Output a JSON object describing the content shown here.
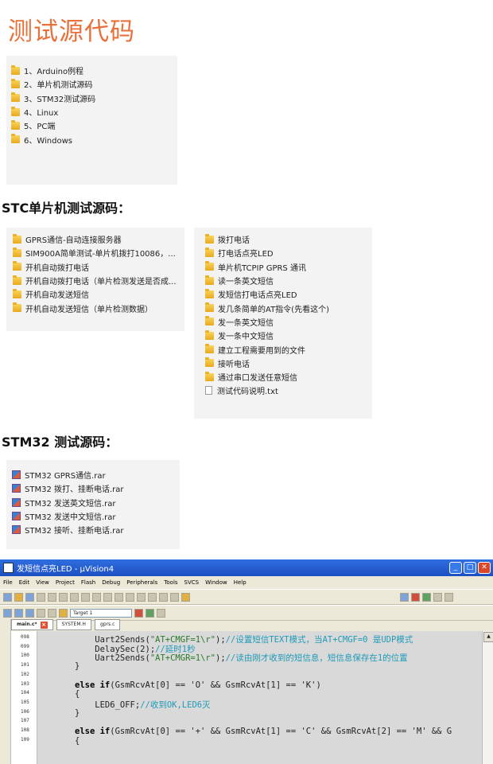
{
  "page_title": "测试源代码",
  "top_folders": [
    "1、Arduino例程",
    "2、单片机测试源码",
    "3、STM32测试源码",
    "4、Linux",
    "5、PC端",
    "6、Windows"
  ],
  "stc": {
    "heading": "STC单片机测试源码：",
    "left": [
      "GPRS通信-自动连接服务器",
      "SIM900A简单测试-单片机拨打10086，...",
      "开机自动拨打电话",
      "开机自动拨打电话（单片检测发送是否成...",
      "开机自动发送短信",
      "开机自动发送短信（单片检测数据）"
    ],
    "right_folders": [
      "拨打电话",
      "打电话点亮LED",
      "单片机TCPIP GPRS 通讯",
      "读一条英文短信",
      "发短信打电话点亮LED",
      "发几条简单的AT指令(先看这个)",
      "发一条英文短信",
      "发一条中文短信",
      "建立工程需要用到的文件",
      "接听电话",
      "通过串口发送任意短信"
    ],
    "right_file": "测试代码说明.txt"
  },
  "stm32": {
    "heading": "STM32 测试源码：",
    "files": [
      "STM32 GPRS通信.rar",
      "STM32 拨打、挂断电话.rar",
      "STM32 发送英文短信.rar",
      "STM32 发送中文短信.rar",
      "STM32 接听、挂断电话.rar"
    ]
  },
  "ide": {
    "window_title": "发短信点亮LED  - µVision4",
    "menu": [
      "File",
      "Edit",
      "View",
      "Project",
      "Flash",
      "Debug",
      "Peripherals",
      "Tools",
      "SVCS",
      "Window",
      "Help"
    ],
    "target": "Target 1",
    "tabs": [
      "main.c*",
      "SYSTEM.H",
      "gprs.c"
    ],
    "lines": [
      {
        "n": "098",
        "code": "    Uart2Sends(\"AT+CMGF=1\\r\");//设置短信TEXT模式，当AT+CMGF=0 是UDP模式"
      },
      {
        "n": "099",
        "code": "    DelaySec(2);//延时1秒"
      },
      {
        "n": "100",
        "code": "    Uart2Sends(\"AT+CMGR=1\\r\");//读由刚才收到的短信息，短信息保存在1的位置"
      },
      {
        "n": "101",
        "code": "}"
      },
      {
        "n": "102",
        "code": ""
      },
      {
        "n": "103",
        "code": "else if(GsmRcvAt[0] == 'O' && GsmRcvAt[1] == 'K')"
      },
      {
        "n": "104",
        "code": "{"
      },
      {
        "n": "105",
        "code": "    LED6_OFF;//收到OK,LED6灭"
      },
      {
        "n": "106",
        "code": "}"
      },
      {
        "n": "107",
        "code": ""
      },
      {
        "n": "108",
        "code": "else if(GsmRcvAt[0] == '+' && GsmRcvAt[1] == 'C' && GsmRcvAt[2] == 'M' && G"
      },
      {
        "n": "109",
        "code": "{"
      }
    ]
  }
}
